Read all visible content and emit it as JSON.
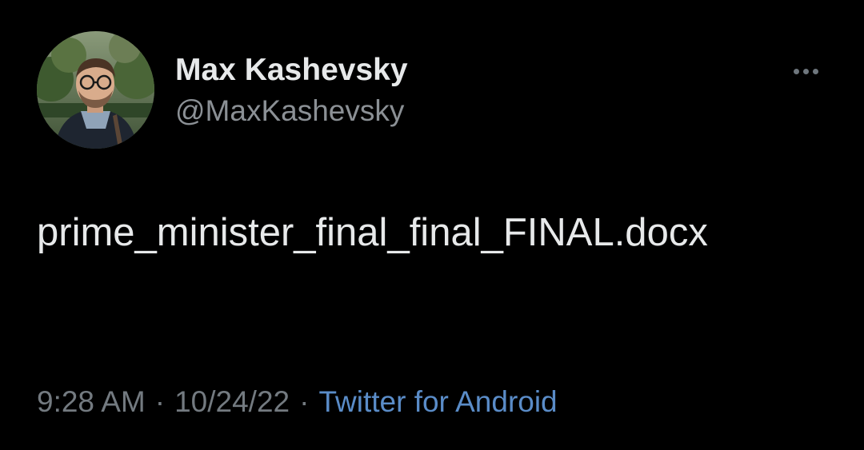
{
  "tweet": {
    "author": {
      "display_name": "Max Kashevsky",
      "handle": "@MaxKashevsky"
    },
    "text": "prime_minister_final_final_FINAL.docx",
    "time": "9:28 AM",
    "date": "10/24/22",
    "separator": "·",
    "source": "Twitter for Android"
  },
  "icons": {
    "more": "more-options-icon"
  },
  "colors": {
    "background": "#000000",
    "primary_text": "#e7e9ea",
    "secondary_text": "#8b9095",
    "meta_text": "#737a80",
    "link": "#5a8cc8"
  }
}
